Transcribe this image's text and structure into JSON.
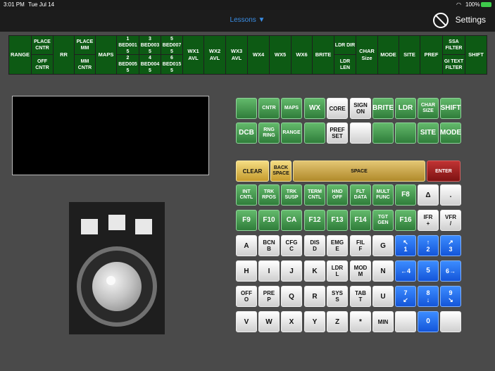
{
  "status": {
    "time": "3:01 PM",
    "date": "Tue Jul 14",
    "battery": "100%"
  },
  "nav": {
    "title": "Lessons ▼",
    "settings": "Settings",
    "no_icon": "prohibited-icon"
  },
  "dcb": {
    "range": "RANGE",
    "place_cntr": "PLACE CNTR",
    "off_cntr": "OFF CNTR",
    "rr": "RR",
    "place_mm": "PLACE MM",
    "mm_cntr": "MM CNTR",
    "maps": "MAPS",
    "bed001": "1 BED001 5",
    "bed003": "3 BED003 5",
    "bed007": "5 BED007 5",
    "bed005": "2 BED005 5",
    "bed004": "4 BED004 5",
    "bed015": "6 BED015 5",
    "wx1": "WX1 AVL",
    "wx2": "WX2 AVL",
    "wx3": "WX3 AVL",
    "wx4": "WX4",
    "wx5": "WX5",
    "wx6": "WX6",
    "brite": "BRITE",
    "ldr_dir": "LDR DIR",
    "ldr_len": "LDR LEN",
    "char_size": "CHAR Size",
    "mode": "MODE",
    "site": "SITE",
    "pref": "PREF",
    "ssa_filter": "SSA FILTER",
    "gi_text_filter": "GI TEXT FILTER",
    "shift": "SHIFT"
  },
  "keys": {
    "cntr": "CNTR",
    "maps": "MAPS",
    "wx": "WX",
    "core": "CORE",
    "sign": "SIGN",
    "on": "ON",
    "brite": "BRITE",
    "ldr": "LDR",
    "char": "CHAR",
    "size": "SIZE",
    "shift": "SHIFT",
    "dcb": "DCB",
    "rng": "RNG",
    "ring": "RING",
    "range": "RANGE",
    "pref": "PREF",
    "set": "SET",
    "site": "SITE",
    "mode": "MODE",
    "clear": "CLEAR",
    "back": "BACK",
    "space_l": "SPACE",
    "space": "SPACE",
    "enter": "ENTER",
    "int": "INT",
    "cntl": "CNTL",
    "trk": "TRK",
    "rpos": "RPOS",
    "susp": "SUSP",
    "term": "TERM",
    "hnd": "HND",
    "off": "OFF",
    "flt": "FLT",
    "data": "DATA",
    "mult": "MULT",
    "func": "FUNC",
    "f8": "F8",
    "delta": "Δ",
    "dot": ".",
    "f9": "F9",
    "f10": "F10",
    "ca": "CA",
    "f12": "F12",
    "f13": "F13",
    "f14": "F14",
    "tgt": "TGT",
    "gen": "GEN",
    "f16": "F16",
    "ifr": "IFR",
    "plus": "+",
    "vfr": "VFR",
    "slash": "/",
    "a": "A",
    "bcn": "BCN",
    "b": "B",
    "cfg": "CFG",
    "c": "C",
    "dis": "DIS",
    "d": "D",
    "emg": "EMG",
    "e": "E",
    "fil": "FIL",
    "f": "F",
    "g": "G",
    "n1": "1",
    "a1": "↖",
    "n2": "2",
    "a2": "↑",
    "n3": "3",
    "a3": "↗",
    "h": "H",
    "i": "I",
    "j": "J",
    "k": "K",
    "ldr2": "LDR",
    "l": "L",
    "mod": "MOD",
    "m": "M",
    "n": "N",
    "n4": "4",
    "a4": "←",
    "n5": "5",
    "n6": "6",
    "a6": "→",
    "off2": "OFF",
    "o": "O",
    "pre": "PRE",
    "p": "P",
    "q": "Q",
    "r": "R",
    "sys": "SYS",
    "s": "S",
    "tab": "TAB",
    "t": "T",
    "u": "U",
    "n7": "7",
    "a7": "↙",
    "n8": "8",
    "a8": "↓",
    "n9": "9",
    "a9": "↘",
    "v": "V",
    "w": "W",
    "x": "X",
    "y": "Y",
    "z": "Z",
    "star": "*",
    "min": "MIN",
    "n0": "0"
  }
}
